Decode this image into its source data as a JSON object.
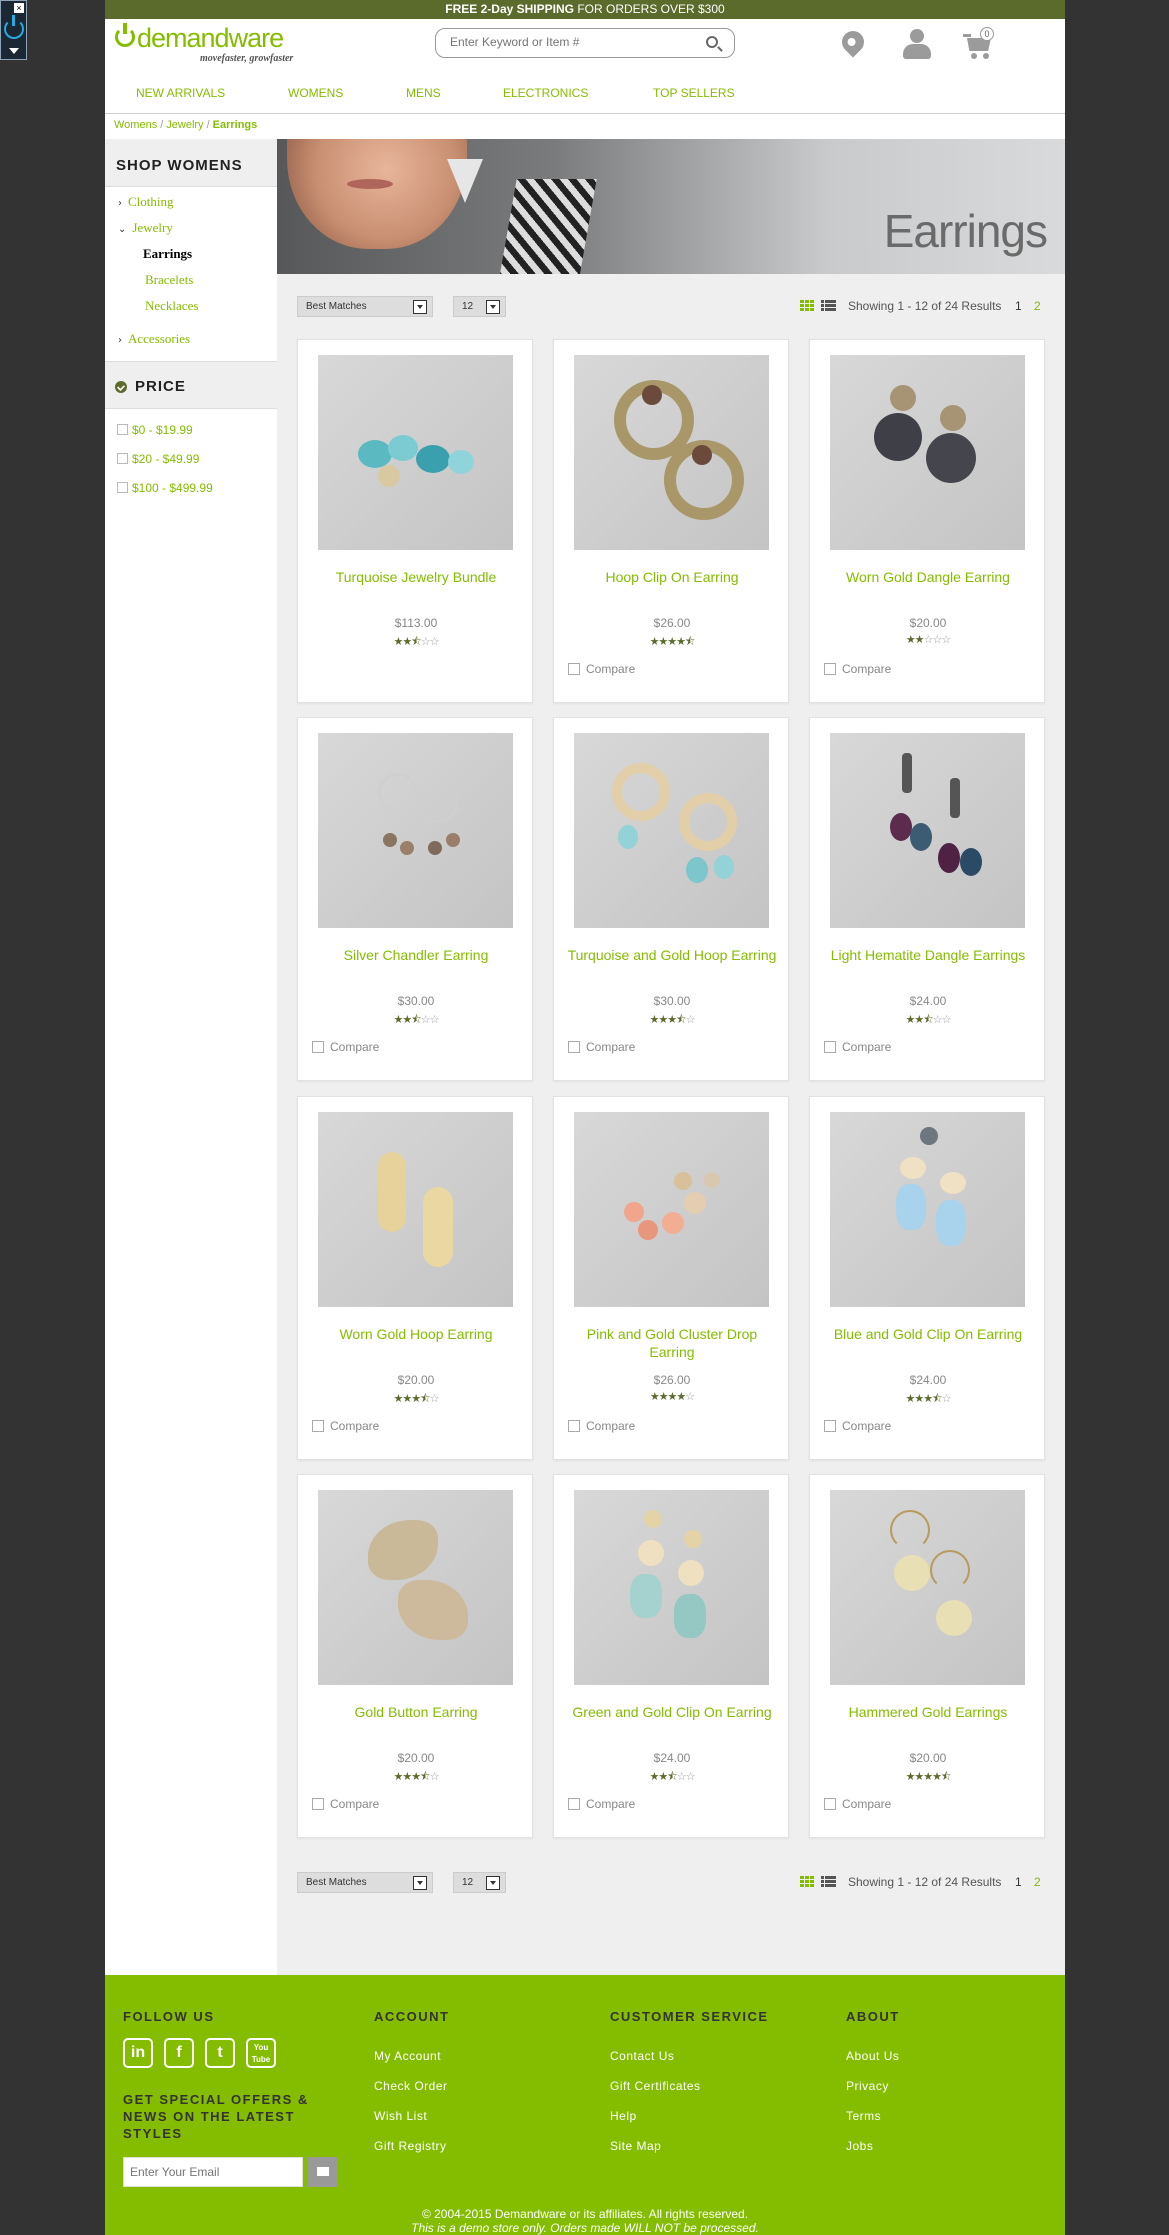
{
  "promo": {
    "bold": "FREE 2-Day SHIPPING",
    "rest": " FOR ORDERS OVER $300"
  },
  "logo": {
    "word": "demandware",
    "tagline": "movefaster, growfaster"
  },
  "search": {
    "placeholder": "Enter Keyword or Item #"
  },
  "cart": {
    "count": "0"
  },
  "nav": [
    "New Arrivals",
    "Womens",
    "Mens",
    "Electronics",
    "Top Sellers"
  ],
  "breadcrumb": [
    "Womens",
    "Jewelry",
    "Earrings"
  ],
  "refine": {
    "title": "SHOP WOMENS",
    "categories": [
      {
        "label": "Clothing",
        "chev": "›"
      },
      {
        "label": "Jewelry",
        "chev": "⌄"
      },
      {
        "label": "Earrings"
      },
      {
        "label": "Bracelets"
      },
      {
        "label": "Necklaces"
      },
      {
        "label": "Accessories",
        "chev": "›"
      }
    ],
    "price_title": "PRICE",
    "price_options": [
      "$0 - $19.99",
      "$20 - $49.99",
      "$100 - $499.99"
    ]
  },
  "banner": {
    "title": "Earrings"
  },
  "toolbar": {
    "sort": "Best Matches",
    "page_size": "12",
    "results": "Showing 1 - 12 of 24 Results",
    "pages": [
      "1",
      "2"
    ]
  },
  "products": [
    {
      "name": "Turquoise Jewelry Bundle",
      "price": "$113.00",
      "rating": 2.5,
      "compare": ""
    },
    {
      "name": "Hoop Clip On Earring",
      "price": "$26.00",
      "rating": 4.5,
      "compare": "Compare"
    },
    {
      "name": "Worn Gold Dangle Earring",
      "price": "$20.00",
      "rating": 2,
      "compare": "Compare"
    },
    {
      "name": "Silver Chandler Earring",
      "price": "$30.00",
      "rating": 2.5,
      "compare": "Compare"
    },
    {
      "name": "Turquoise and Gold Hoop Earring",
      "price": "$30.00",
      "rating": 3.5,
      "compare": "Compare"
    },
    {
      "name": "Light Hematite Dangle Earrings",
      "price": "$24.00",
      "rating": 2.5,
      "compare": "Compare"
    },
    {
      "name": "Worn Gold Hoop Earring",
      "price": "$20.00",
      "rating": 3.5,
      "compare": "Compare"
    },
    {
      "name": "Pink and Gold Cluster Drop Earring",
      "price": "$26.00",
      "rating": 4,
      "compare": "Compare"
    },
    {
      "name": "Blue and Gold Clip On Earring",
      "price": "$24.00",
      "rating": 3.5,
      "compare": "Compare"
    },
    {
      "name": "Gold Button Earring",
      "price": "$20.00",
      "rating": 3.5,
      "compare": "Compare"
    },
    {
      "name": "Green and Gold Clip On Earring",
      "price": "$24.00",
      "rating": 2.5,
      "compare": "Compare"
    },
    {
      "name": "Hammered Gold Earrings",
      "price": "$20.00",
      "rating": 4.5,
      "compare": "Compare"
    }
  ],
  "footer": {
    "follow": "FOLLOW US",
    "social": [
      "in",
      "f",
      "t",
      "You Tube"
    ],
    "offers": "GET SPECIAL OFFERS & NEWS ON THE LATEST STYLES",
    "email_placeholder": "Enter Your Email",
    "columns": [
      {
        "title": "ACCOUNT",
        "links": [
          "My Account",
          "Check Order",
          "Wish List",
          "Gift Registry"
        ]
      },
      {
        "title": "CUSTOMER SERVICE",
        "links": [
          "Contact Us",
          "Gift Certificates",
          "Help",
          "Site Map"
        ]
      },
      {
        "title": "ABOUT",
        "links": [
          "About Us",
          "Privacy",
          "Terms",
          "Jobs"
        ]
      }
    ],
    "copyright": "© 2004-2015 Demandware or its affiliates. All rights reserved.",
    "demo_note": "This is a demo store only. Orders made WILL NOT be processed."
  },
  "colors": {
    "brand": "#84bd00",
    "promo_bg": "#5b6b2c",
    "outer_bg": "#333333"
  }
}
